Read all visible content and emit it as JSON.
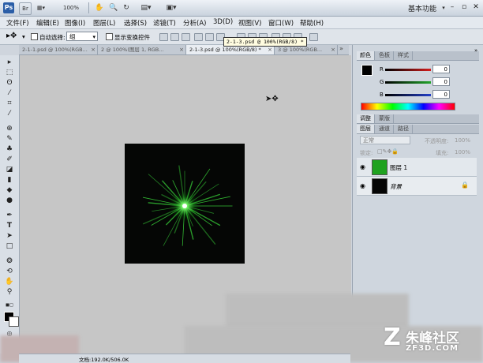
{
  "titlebar": {
    "app_logo": "Ps",
    "zoom": "100%",
    "workspace": "基本功能",
    "minimize": "–",
    "restore": "▫",
    "close": "✕"
  },
  "menu": [
    {
      "label": "文件(F)"
    },
    {
      "label": "编辑(E)"
    },
    {
      "label": "图像(I)"
    },
    {
      "label": "图层(L)"
    },
    {
      "label": "选择(S)"
    },
    {
      "label": "滤镜(T)"
    },
    {
      "label": "分析(A)"
    },
    {
      "label": "3D(D)"
    },
    {
      "label": "视图(V)"
    },
    {
      "label": "窗口(W)"
    },
    {
      "label": "帮助(H)"
    }
  ],
  "options": {
    "auto_select_label": "自动选择:",
    "auto_select_value": "组",
    "show_transform_label": "显示变换控件"
  },
  "tooltip": "2-1-3.psd @ 100%(RGB/8) *",
  "doc_tabs": [
    {
      "label": "2-1-1.psd @ 100%(RGB..."
    },
    {
      "label": "2 @ 100%(图层 1, RGB..."
    },
    {
      "label": "2-1-3.psd @ 100%(RGB/8) *"
    },
    {
      "label": "3 @ 100%(RGB..."
    }
  ],
  "color_panel": {
    "tabs": [
      "颜色",
      "色板",
      "样式"
    ],
    "channels": [
      {
        "name": "R",
        "value": "0",
        "color": "#d41d1d"
      },
      {
        "name": "G",
        "value": "0",
        "color": "#22a52a"
      },
      {
        "name": "B",
        "value": "0",
        "color": "#2440c8"
      }
    ]
  },
  "adjust_tabs": [
    "调整",
    "蒙版"
  ],
  "layers_panel": {
    "tabs": [
      "图层",
      "通道",
      "路径"
    ],
    "blend_mode": "正常",
    "opacity_label": "不透明度:",
    "opacity_value": "100%",
    "lock_label": "锁定:",
    "fill_label": "填充:",
    "fill_value": "100%",
    "layers": [
      {
        "name": "图层 1",
        "thumb_color": "#1fa21f"
      },
      {
        "name": "背景",
        "thumb_color": "#050505"
      }
    ]
  },
  "status": {
    "doc_size": "文档:192.0K/506.0K"
  },
  "watermark": {
    "icon": "Z",
    "name": "朱峰社区",
    "domain": "ZF3D.COM"
  }
}
